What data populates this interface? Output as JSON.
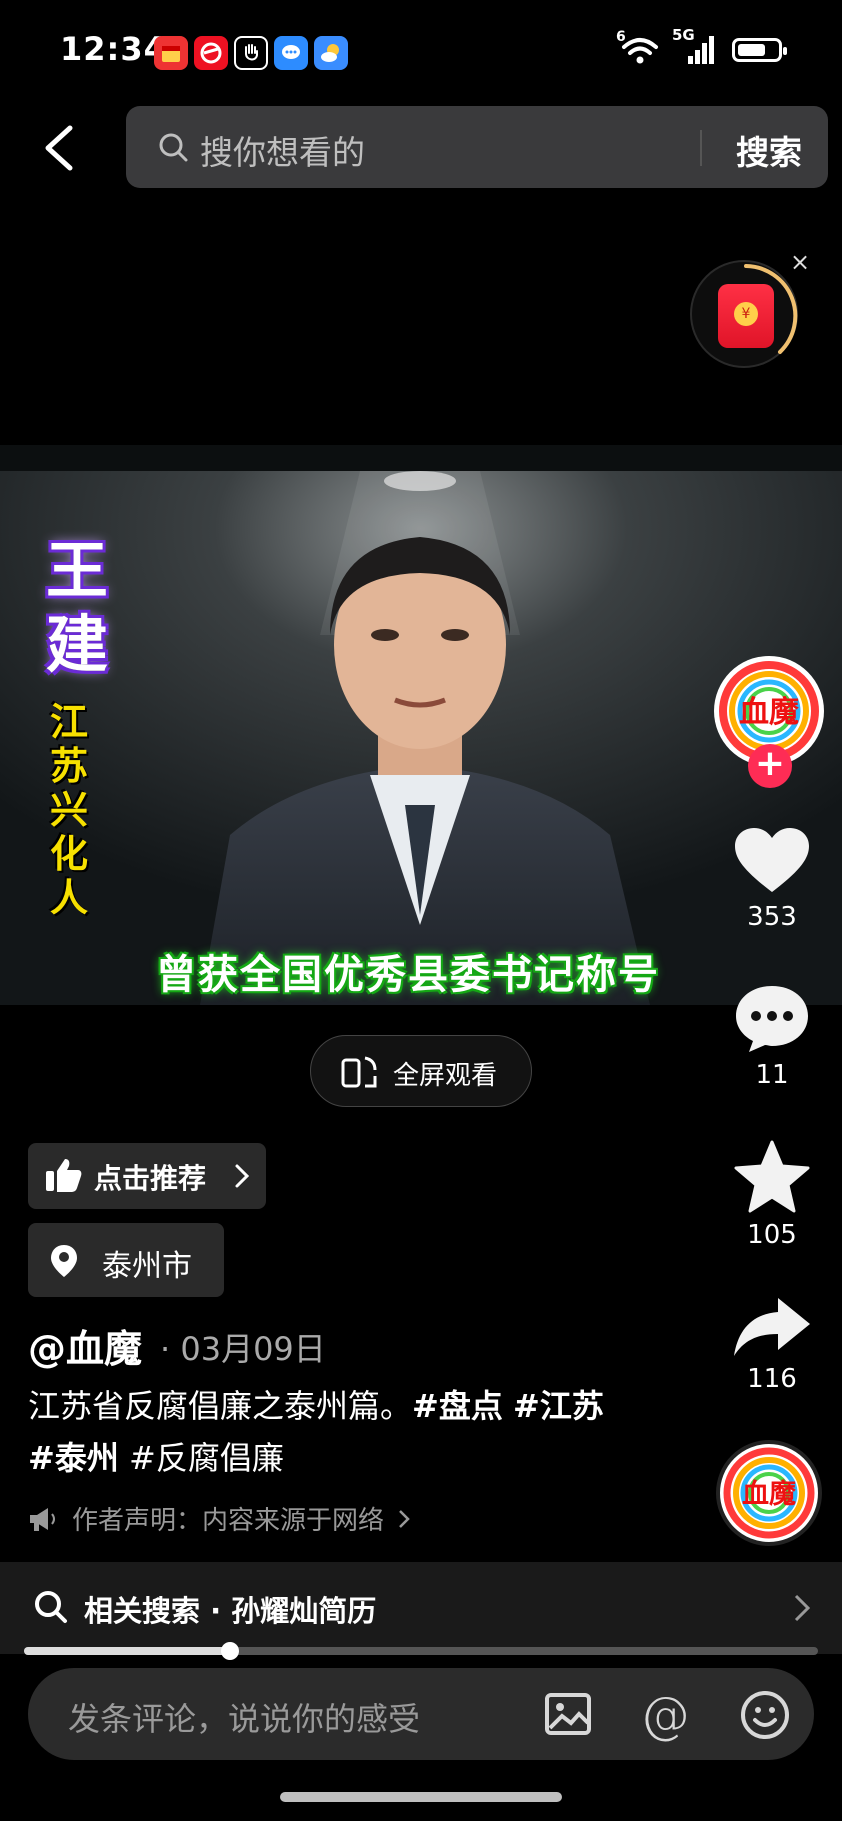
{
  "status_bar": {
    "time": "12:34",
    "app_icons": [
      "calendar-app-icon",
      "news-app-icon",
      "hand-app-icon",
      "message-app-icon",
      "weather-app-icon"
    ],
    "signal_labels": {
      "wifi": "6",
      "network": "5G"
    },
    "battery_level": 0.7
  },
  "top_bar": {
    "search_placeholder": "搜你想看的",
    "search_button": "搜索"
  },
  "red_packet": {
    "seal": "¥",
    "close": "×"
  },
  "video": {
    "overlay_name": [
      "王",
      "建"
    ],
    "overlay_origin": [
      "江",
      "苏",
      "兴",
      "化",
      "人"
    ],
    "caption": "曾获全国优秀县委书记称号"
  },
  "fullscreen": {
    "label": "全屏观看"
  },
  "right_rail": {
    "avatar_text": "血魔",
    "follow": "+",
    "likes": "353",
    "comments": "11",
    "favorites": "105",
    "shares": "116"
  },
  "post": {
    "recommend_label": "点击推荐",
    "location": "泰州市",
    "author": "@血魔",
    "date": "· 03月09日",
    "description_text": "江苏省反腐倡廉之泰州篇。",
    "tags_bold": [
      "#盘点",
      "#江苏",
      "#泰州"
    ],
    "tag_plain": "#反腐倡廉",
    "statement": "作者声明：内容来源于网络"
  },
  "related_search": {
    "text": "相关搜索 · 孙耀灿简历"
  },
  "progress": {
    "fraction": 0.26
  },
  "comment_bar": {
    "placeholder": "发条评论，说说你的感受"
  },
  "colors": {
    "accent": "#fe2c55",
    "caption_glow": "#21ff21",
    "name_outline": "#6b2bd6"
  }
}
